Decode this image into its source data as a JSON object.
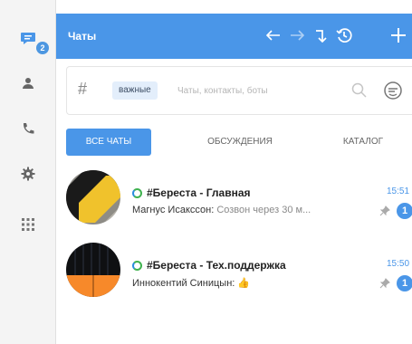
{
  "rail": {
    "chats_badge": "2",
    "items": [
      {
        "name": "chats-icon",
        "active": true
      },
      {
        "name": "contacts-icon"
      },
      {
        "name": "calls-icon"
      },
      {
        "name": "settings-icon"
      },
      {
        "name": "apps-grid-icon"
      }
    ]
  },
  "header": {
    "title": "Чаты"
  },
  "search": {
    "hash": "#",
    "chip": "важные",
    "placeholder": "Чаты, контакты, боты"
  },
  "tabs": [
    {
      "label": "ВСЕ ЧАТЫ",
      "active": true
    },
    {
      "label": "ОБСУЖДЕНИЯ"
    },
    {
      "label": "КАТАЛОГ"
    }
  ],
  "chats": [
    {
      "name": "#Береста - Главная",
      "author": "Магнус Исакссон:",
      "text": "Созвон через 30 м...",
      "time": "15:51",
      "unread": "1"
    },
    {
      "name": "#Береста - Тех.поддержка",
      "author": "Иннокентий Синицын:",
      "text": "👍",
      "time": "15:50",
      "unread": "1"
    }
  ],
  "colors": {
    "accent": "#4a96e8",
    "rail_bg": "#f4f4f4",
    "status_green": "#3fb24f"
  }
}
